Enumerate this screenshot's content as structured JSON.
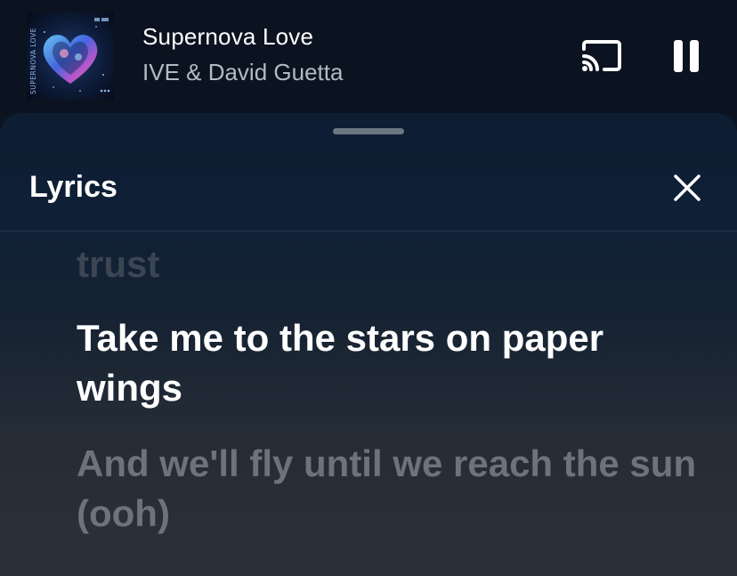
{
  "now_playing": {
    "album_art": {
      "side_text": "SUPERNOVA LOVE",
      "icon": "heart-galaxy-cover-art"
    },
    "title": "Supernova Love",
    "artist": "IVE & David Guetta",
    "cast_icon": "cast-icon",
    "pause_icon": "pause-icon"
  },
  "lyrics_panel": {
    "title": "Lyrics",
    "close_icon": "close-icon",
    "lines": {
      "previous": "trust",
      "current": "Take me to the stars on paper wings",
      "next": "And we'll fly until we reach the sun (ooh)"
    }
  },
  "colors": {
    "background": "#0b1320",
    "sheet_top": "#0d1e33",
    "active_lyric": "#ffffff",
    "inactive_lyric": "#6d7379",
    "artist_text": "#b4bac4"
  }
}
